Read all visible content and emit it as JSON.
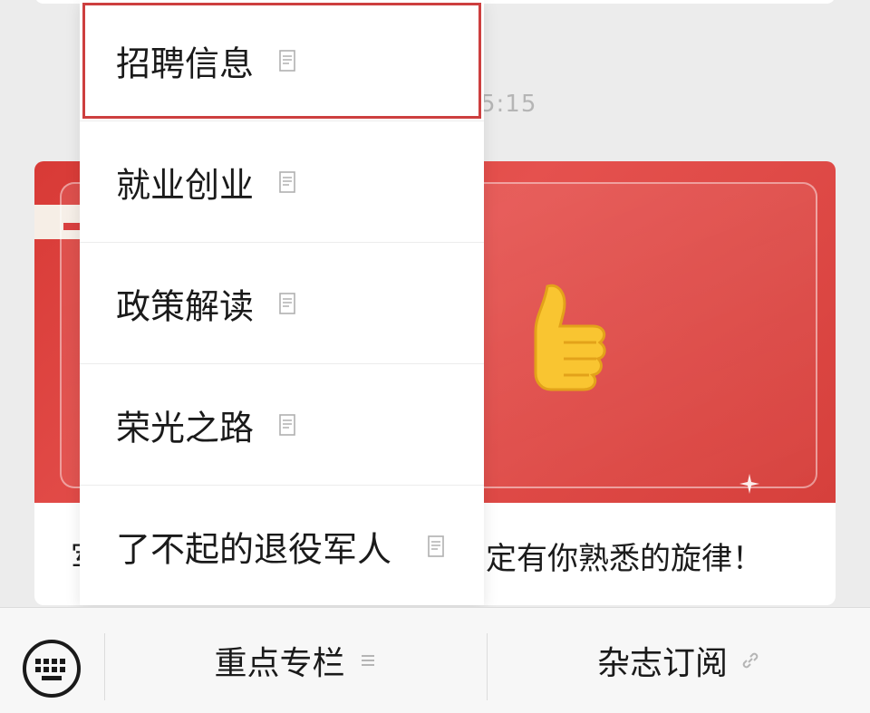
{
  "timestamp": "5:15",
  "article": {
    "title_prefix": "军",
    "title_visible": "定有你熟悉的旋律！"
  },
  "submenu": {
    "items": [
      {
        "label": "招聘信息",
        "icon": "document-icon",
        "selected": true
      },
      {
        "label": "就业创业",
        "icon": "document-icon",
        "selected": false
      },
      {
        "label": "政策解读",
        "icon": "document-icon",
        "selected": false
      },
      {
        "label": "荣光之路",
        "icon": "document-icon",
        "selected": false
      },
      {
        "label": "了不起的退役军人",
        "icon": "document-icon",
        "selected": false
      }
    ]
  },
  "bottom_bar": {
    "keyboard_icon": "keyboard-icon",
    "tabs": [
      {
        "label": "重点专栏",
        "icon": "menu-lines-icon"
      },
      {
        "label": "杂志订阅",
        "icon": "link-icon"
      }
    ]
  },
  "colors": {
    "accent_red": "#d83a36",
    "selected_outline": "#cd3f3f"
  }
}
